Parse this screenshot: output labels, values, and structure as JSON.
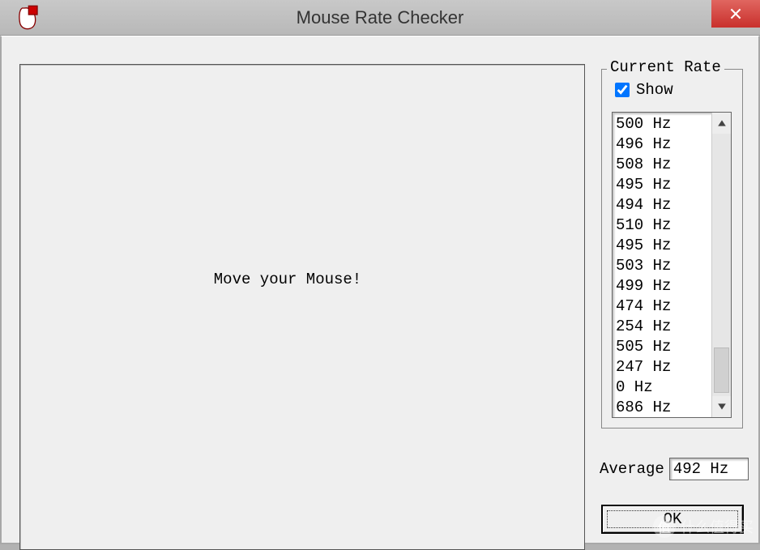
{
  "title": "Mouse Rate Checker",
  "canvas_message": "Move your Mouse!",
  "groupbox": {
    "label": "Current Rate",
    "show_label": "Show",
    "show_checked": true
  },
  "rates": [
    "500 Hz",
    "496 Hz",
    "508 Hz",
    "495 Hz",
    "494 Hz",
    "510 Hz",
    "495 Hz",
    "503 Hz",
    "499 Hz",
    "474 Hz",
    "254 Hz",
    "505 Hz",
    "247 Hz",
    "0 Hz",
    "686 Hz"
  ],
  "average_label": "Average",
  "average_value": "492 Hz",
  "ok_label": "OK",
  "watermark": "什么值得买"
}
